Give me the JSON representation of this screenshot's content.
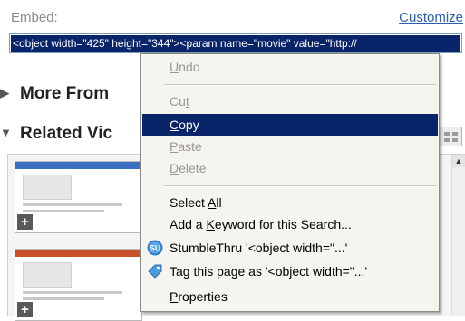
{
  "embed": {
    "label": "Embed:",
    "customize_label": "Customize",
    "value": "<object width=\"425\" height=\"344\"><param name=\"movie\" value=\"http://"
  },
  "sections": {
    "more_from": "More From",
    "related": "Related Vic"
  },
  "context_menu": {
    "undo": {
      "pre": "",
      "key": "U",
      "post": "ndo",
      "enabled": false
    },
    "cut": {
      "pre": "Cu",
      "key": "t",
      "post": "",
      "enabled": false
    },
    "copy": {
      "pre": "",
      "key": "C",
      "post": "opy",
      "enabled": true
    },
    "paste": {
      "pre": "",
      "key": "P",
      "post": "aste",
      "enabled": false
    },
    "delete": {
      "pre": "",
      "key": "D",
      "post": "elete",
      "enabled": false
    },
    "select_all": {
      "pre": "Select ",
      "key": "A",
      "post": "ll",
      "enabled": true
    },
    "add_keyword": {
      "pre": "Add a ",
      "key": "K",
      "post": "eyword for this Search...",
      "enabled": true
    },
    "stumble": {
      "label": "StumbleThru '<object width=\"...'",
      "icon": "stumbleupon-icon"
    },
    "tag": {
      "label": "Tag this page as '<object width=\"...'",
      "icon": "tag-icon"
    },
    "properties": {
      "pre": "",
      "key": "P",
      "post": "roperties",
      "enabled": true
    }
  },
  "colors": {
    "selection": "#0a246a",
    "menu_bg": "#f6f4ef",
    "link": "#2a5db0",
    "stumble_icon": "#2f7fd0",
    "tag_icon": "#4f9be0"
  }
}
